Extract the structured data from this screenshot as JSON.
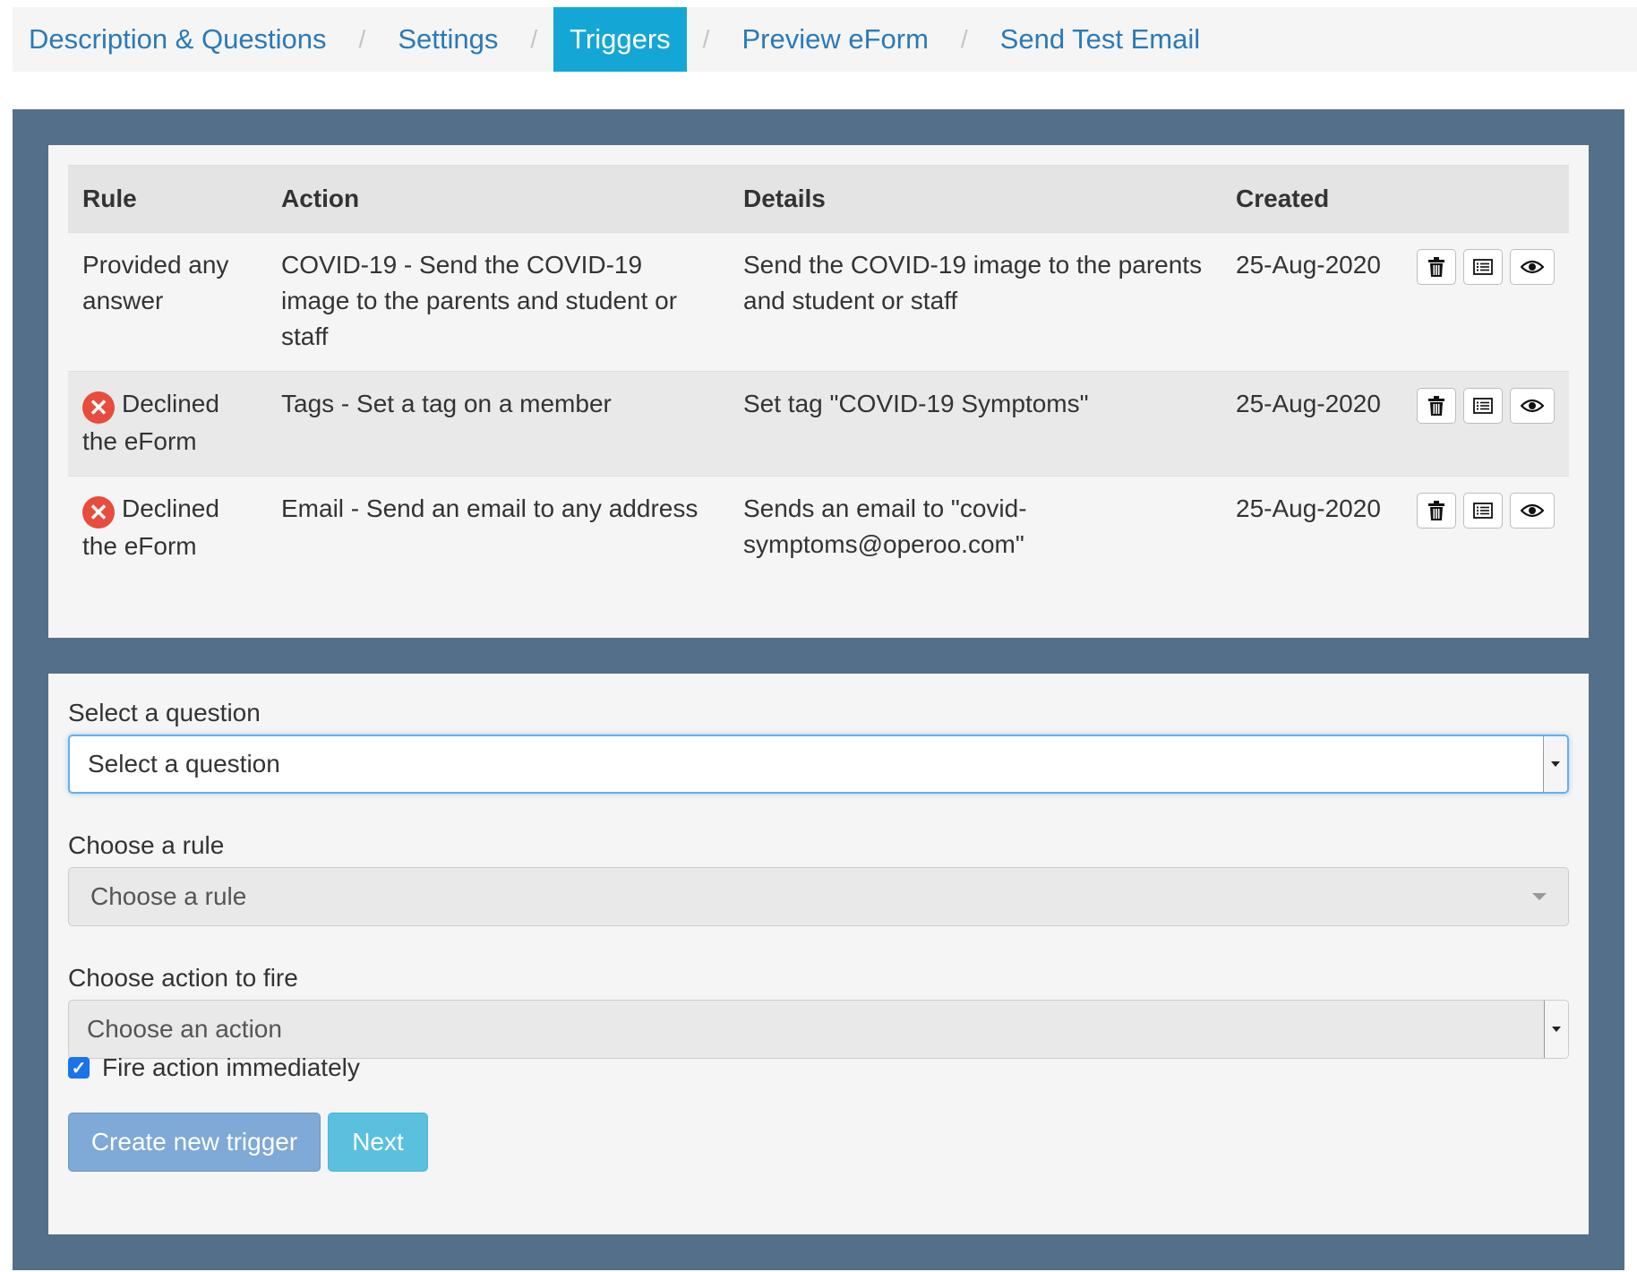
{
  "nav": {
    "items": [
      {
        "label": "Description & Questions"
      },
      {
        "label": "Settings"
      },
      {
        "label": "Triggers"
      },
      {
        "label": "Preview eForm"
      },
      {
        "label": "Send Test Email"
      }
    ],
    "separator": "/"
  },
  "table": {
    "headers": {
      "rule": "Rule",
      "action": "Action",
      "details": "Details",
      "created": "Created"
    },
    "rows": [
      {
        "rule": "Provided any answer",
        "action": "COVID-19 - Send the COVID-19 image to the parents and student or staff",
        "details": "Send the COVID-19 image to the parents and student or staff",
        "created": "25-Aug-2020"
      },
      {
        "rule": "Declined the eForm",
        "action": "Tags - Set a tag on a member",
        "details": "Set tag \"COVID-19 Symptoms\"",
        "created": "25-Aug-2020"
      },
      {
        "rule": "Declined the eForm",
        "action": "Email - Send an email to any address",
        "details": "Sends an email to \"covid-symptoms@operoo.com\"",
        "created": "25-Aug-2020"
      }
    ]
  },
  "form": {
    "question_label": "Select a question",
    "question_value": "Select a question",
    "rule_label": "Choose a rule",
    "rule_value": "Choose a rule",
    "action_label": "Choose action to fire",
    "action_value": "Choose an action",
    "fire_immediately_label": "Fire action immediately",
    "fire_immediately_checked": true,
    "create_button": "Create new trigger",
    "next_button": "Next"
  },
  "colors": {
    "accent": "#14a7d6",
    "frame": "#546f8a",
    "link": "#2a7ab8",
    "danger": "#e74c3c"
  }
}
